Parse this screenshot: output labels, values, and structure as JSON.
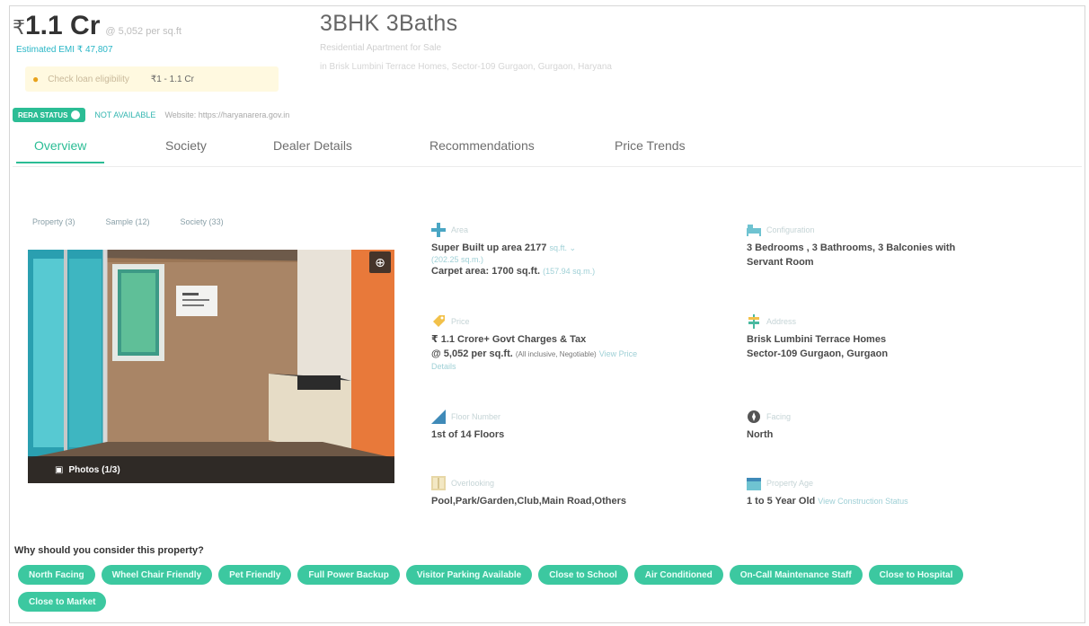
{
  "header": {
    "price_symbol": "₹",
    "price": "1.1 Cr",
    "price_per_sqft": "@ 5,052 per sq.ft",
    "emi_text": "Estimated EMI ₹ 47,807",
    "emi_chip_label": "Check loan eligibility",
    "emi_chip_value": "₹1 - 1.1 Cr",
    "title": "3BHK 3Baths",
    "subtitle": "Residential Apartment for Sale",
    "address": "in Brisk Lumbini Terrace Homes, Sector-109 Gurgaon, Gurgaon, Haryana"
  },
  "rera": {
    "badge": "RERA STATUS",
    "number": "NOT AVAILABLE",
    "website": "Website: https://haryanarera.gov.in"
  },
  "tabs": [
    {
      "label": "Overview"
    },
    {
      "label": "Society"
    },
    {
      "label": "Dealer Details"
    },
    {
      "label": "Recommendations"
    },
    {
      "label": "Price Trends"
    }
  ],
  "photo_tabs": [
    {
      "label": "Property (3)"
    },
    {
      "label": "Sample (12)"
    },
    {
      "label": "Society (33)"
    }
  ],
  "photo": {
    "caption": "Photos (1/3)"
  },
  "details": {
    "area": {
      "label": "Area",
      "line1": "Super Built up area 2177",
      "unit": "sq.ft. ⌄",
      "line1b": "(202.25 sq.m.)",
      "line2": "Carpet area: 1700 sq.ft.",
      "line2b": "(157.94 sq.m.)"
    },
    "config": {
      "label": "Configuration",
      "line1": "3 Bedrooms , 3 Bathrooms, 3 Balconies with",
      "line2": "Servant Room"
    },
    "price": {
      "label": "Price",
      "line1": "₹ 1.1 Crore+ Govt Charges & Tax",
      "line2": "@ 5,052 per sq.ft.",
      "line2small": "(All inclusive, Negotiable)",
      "link": "View Price",
      "link2": "Details"
    },
    "address": {
      "label": "Address",
      "line1": "Brisk Lumbini Terrace Homes",
      "line2": "Sector-109 Gurgaon, Gurgaon"
    },
    "floor": {
      "label": "Floor Number",
      "line1": "1st  of 14 Floors"
    },
    "facing": {
      "label": "Facing",
      "line1": "North"
    },
    "overlooking": {
      "label": "Overlooking",
      "line1": "Pool,Park/Garden,Club,Main Road,Others"
    },
    "age": {
      "label": "Property Age",
      "line1": "1 to 5 Year Old",
      "link": "View Construction Status"
    }
  },
  "why": {
    "title": "Why should you consider this property?",
    "chips": [
      "North Facing",
      "Wheel Chair Friendly",
      "Pet Friendly",
      "Full Power Backup",
      "Visitor Parking Available",
      "Close to School",
      "Air Conditioned",
      "On-Call Maintenance Staff",
      "Close to Hospital",
      "Close to Market"
    ]
  },
  "colors": {
    "accent": "#2bbd95",
    "chip": "#3cc8a0",
    "link": "#29b6c6"
  }
}
